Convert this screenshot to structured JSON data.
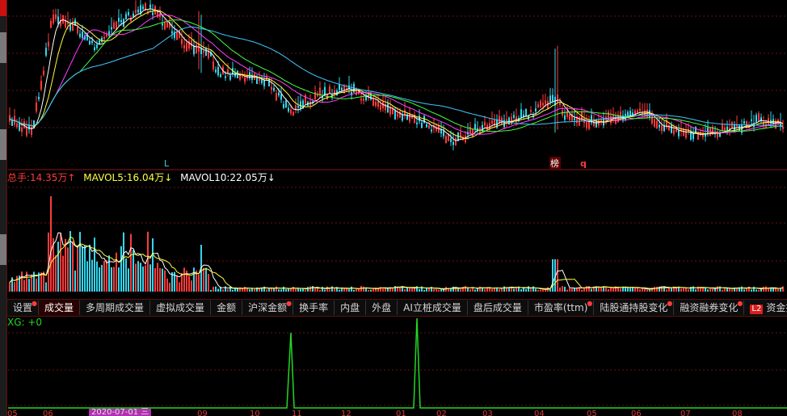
{
  "indicator_bar": {
    "label1": "总手:",
    "value1": "14.35万↑",
    "label2": "MAVOL5:",
    "value2": "16.04万↓",
    "label3": "MAVOL10:",
    "value3": "22.05万↓"
  },
  "markers": {
    "marker_l": "L",
    "marker_bang": "榜",
    "marker_q": "q"
  },
  "tabs": [
    {
      "label": "设置",
      "active": false,
      "dot": true
    },
    {
      "label": "成交量",
      "active": true,
      "dot": false
    },
    {
      "label": "多周期成交量",
      "active": false,
      "dot": false
    },
    {
      "label": "虚拟成交量",
      "active": false,
      "dot": false
    },
    {
      "label": "金额",
      "active": false,
      "dot": false
    },
    {
      "label": "沪深金额",
      "active": false,
      "dot": true
    },
    {
      "label": "换手率",
      "active": false,
      "dot": false
    },
    {
      "label": "内盘",
      "active": false,
      "dot": false
    },
    {
      "label": "外盘",
      "active": false,
      "dot": false
    },
    {
      "label": "AI立桩成交量",
      "active": false,
      "dot": false
    },
    {
      "label": "盘后成交量",
      "active": false,
      "dot": false
    },
    {
      "label": "市盈率(ttm)",
      "active": false,
      "dot": true
    },
    {
      "label": "陆股通持股变化",
      "active": false,
      "dot": true
    },
    {
      "label": "融资融券变化",
      "active": false,
      "dot": true
    },
    {
      "label": "资金抄底",
      "active": false,
      "dot": false,
      "badge": "L2"
    }
  ],
  "xg_panel": {
    "label": "XG: +0"
  },
  "bottom_axis": {
    "labels": [
      "05",
      "06",
      "09",
      "10",
      "11",
      "12",
      "01",
      "02",
      "03",
      "04",
      "05",
      "06",
      "07",
      "08"
    ],
    "date_badge": "2020-07-01 三"
  },
  "colors": {
    "up": "#ff3b3b",
    "down": "#35d6ee",
    "ma5": "#ffffff",
    "ma10": "#ffff40",
    "ma20": "#ff40ff",
    "ma30": "#40ff40",
    "ma60": "#40c8ff",
    "signal": "#22d822",
    "grid": "#6b0f0f"
  }
}
